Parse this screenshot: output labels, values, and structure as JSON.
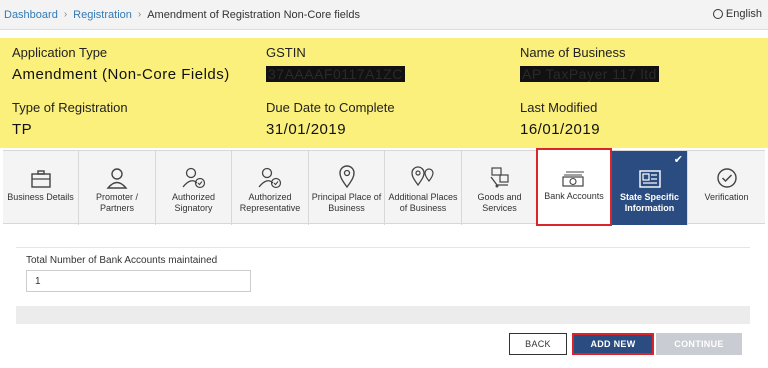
{
  "breadcrumb": {
    "items": [
      "Dashboard",
      "Registration"
    ],
    "current": "Amendment of Registration Non-Core fields",
    "separator": "›"
  },
  "language": {
    "label": "English"
  },
  "info": {
    "application_type": {
      "label": "Application Type",
      "value": "Amendment (Non-Core Fields)"
    },
    "gstin": {
      "label": "GSTIN",
      "value": "37AAAAF0117A1ZC"
    },
    "business_name": {
      "label": "Name of Business",
      "value": "AP TaxPayer 117 ltd"
    },
    "registration_type": {
      "label": "Type of Registration",
      "value": "TP"
    },
    "due_date": {
      "label": "Due Date to Complete",
      "value": "31/01/2019"
    },
    "last_modified": {
      "label": "Last Modified",
      "value": "16/01/2019"
    }
  },
  "tabs": [
    {
      "label": "Business Details",
      "icon": "briefcase-icon"
    },
    {
      "label": "Promoter / Partners",
      "icon": "person-icon"
    },
    {
      "label": "Authorized Signatory",
      "icon": "person-check-icon"
    },
    {
      "label": "Authorized Representative",
      "icon": "person-check-icon"
    },
    {
      "label": "Principal Place of Business",
      "icon": "location-pin-icon"
    },
    {
      "label": "Additional Places of Business",
      "icon": "multiple-pins-icon"
    },
    {
      "label": "Goods and Services",
      "icon": "goods-icon"
    },
    {
      "label": "Bank Accounts",
      "icon": "bank-note-icon"
    },
    {
      "label": "State Specific Information",
      "icon": "id-card-icon"
    },
    {
      "label": "Verification",
      "icon": "check-circle-icon"
    }
  ],
  "form": {
    "bank_count_label": "Total Number of Bank Accounts maintained",
    "bank_count_value": "1"
  },
  "buttons": {
    "back": "BACK",
    "add_new": "ADD NEW",
    "continue": "CONTINUE"
  },
  "colors": {
    "accent": "#2b4c81",
    "highlight": "#d8262a",
    "panel": "#fbf07b"
  }
}
